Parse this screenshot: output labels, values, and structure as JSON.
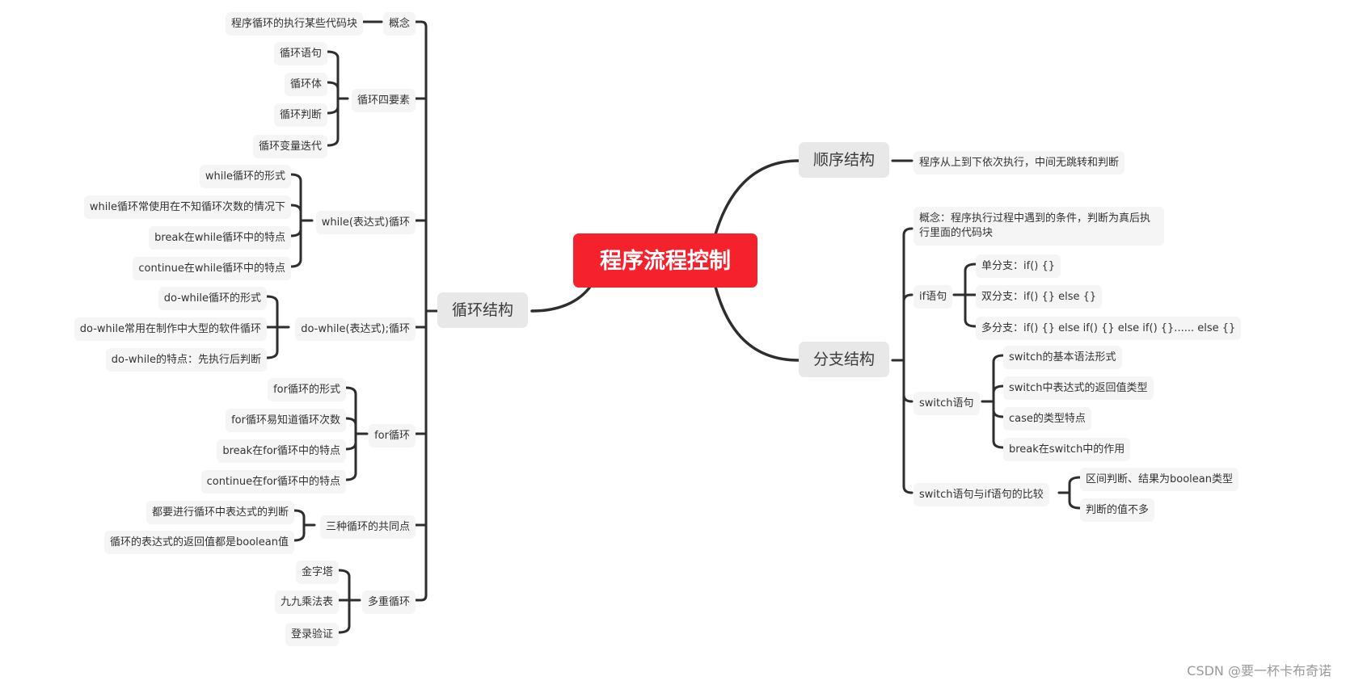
{
  "root": {
    "label": "程序流程控制",
    "color": "#f5222d"
  },
  "branches": {
    "loop": {
      "label": "循环结构",
      "children": [
        {
          "label": "概念",
          "children": [
            "程序循环的执行某些代码块"
          ]
        },
        {
          "label": "循环四要素",
          "children": [
            "循环语句",
            "循环体",
            "循环判断",
            "循环变量迭代"
          ]
        },
        {
          "label": "while(表达式)循环",
          "children": [
            "while循环的形式",
            "while循环常使用在不知循环次数的情况下",
            "break在while循环中的特点",
            "continue在while循环中的特点"
          ]
        },
        {
          "label": "do-while(表达式);循环",
          "children": [
            "do-while循环的形式",
            "do-while常用在制作中大型的软件循环",
            "do-while的特点：先执行后判断"
          ]
        },
        {
          "label": "for循环",
          "children": [
            "for循环的形式",
            "for循环易知道循环次数",
            "break在for循环中的特点",
            "continue在for循环中的特点"
          ]
        },
        {
          "label": "三种循环的共同点",
          "children": [
            "都要进行循环中表达式的判断",
            "循环的表达式的返回值都是boolean值"
          ]
        },
        {
          "label": "多重循环",
          "children": [
            "金字塔",
            "九九乘法表",
            "登录验证"
          ]
        }
      ]
    },
    "sequence": {
      "label": "顺序结构",
      "children": [
        "程序从上到下依次执行，中间无跳转和判断"
      ]
    },
    "branch": {
      "label": "分支结构",
      "children": [
        {
          "label": "概念：程序执行过程中遇到的条件，判断为真后执行里面的代码块",
          "children": []
        },
        {
          "label": "if语句",
          "children": [
            "单分支：if() {}",
            "双分支：if() {} else {}",
            "多分支：if() {} else if() {} else if() {}...... else {}"
          ]
        },
        {
          "label": "switch语句",
          "children": [
            "switch的基本语法形式",
            "switch中表达式的返回值类型",
            "case的类型特点",
            "break在switch中的作用"
          ]
        },
        {
          "label": "switch语句与if语句的比较",
          "children": [
            "区间判断、结果为boolean类型",
            "判断的值不多"
          ]
        }
      ]
    }
  },
  "watermark": "CSDN @要一杯卡布奇诺"
}
